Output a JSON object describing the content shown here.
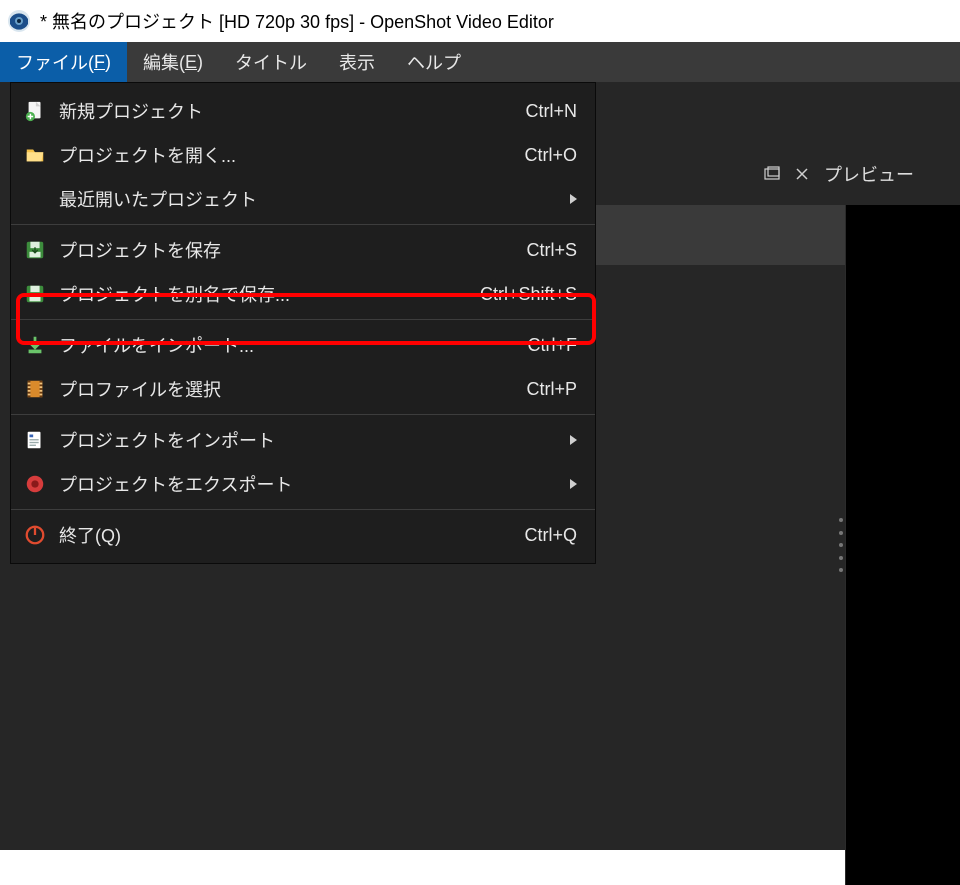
{
  "titlebar": {
    "title": "* 無名のプロジェクト [HD 720p 30 fps] - OpenShot Video Editor"
  },
  "menubar": {
    "items": [
      {
        "label_pre": "ファイル(",
        "mnemonic": "F",
        "label_post": ")",
        "active": true
      },
      {
        "label_pre": "編集(",
        "mnemonic": "E",
        "label_post": ")",
        "active": false
      },
      {
        "label_pre": "タイトル",
        "mnemonic": "",
        "label_post": "",
        "active": false
      },
      {
        "label_pre": "表示",
        "mnemonic": "",
        "label_post": "",
        "active": false
      },
      {
        "label_pre": "ヘルプ",
        "mnemonic": "",
        "label_post": "",
        "active": false
      }
    ]
  },
  "file_menu": {
    "items": [
      {
        "icon": "new-project",
        "label": "新規プロジェクト",
        "shortcut": "Ctrl+N"
      },
      {
        "icon": "open-project",
        "label": "プロジェクトを開く...",
        "shortcut": "Ctrl+O"
      },
      {
        "icon": "",
        "label": "最近開いたプロジェクト",
        "submenu": true
      },
      {
        "separator": true
      },
      {
        "icon": "save",
        "label": "プロジェクトを保存",
        "shortcut": "Ctrl+S"
      },
      {
        "icon": "save-as",
        "label": "プロジェクトを別名で保存...",
        "shortcut": "Ctrl+Shift+S",
        "highlighted": true
      },
      {
        "separator": true
      },
      {
        "icon": "import",
        "label": "ファイルをインポート...",
        "shortcut": "Ctrl+F"
      },
      {
        "icon": "profile",
        "label": "プロファイルを選択",
        "shortcut": "Ctrl+P"
      },
      {
        "separator": true
      },
      {
        "icon": "import-project",
        "label": "プロジェクトをインポート",
        "submenu": true
      },
      {
        "icon": "export",
        "label": "プロジェクトをエクスポート",
        "submenu": true
      },
      {
        "separator": true
      },
      {
        "icon": "quit",
        "label_pre": "終了(",
        "mnemonic": "Q",
        "label_post": ")",
        "shortcut": "Ctrl+Q"
      }
    ]
  },
  "preview": {
    "label": "プレビュー"
  }
}
